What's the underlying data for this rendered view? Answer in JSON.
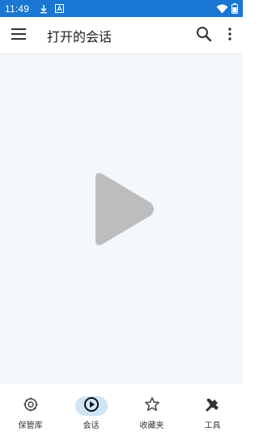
{
  "status_bar": {
    "time": "11:49",
    "icons": [
      "download-icon",
      "app-a-icon",
      "wifi-icon",
      "battery-icon"
    ],
    "background": "#1976d2"
  },
  "app_bar": {
    "title": "打开的会话",
    "icons": [
      "menu-icon",
      "search-icon",
      "more-vert-icon"
    ]
  },
  "content": {
    "icon": "play-icon",
    "background": "#f3f8fd",
    "icon_color": "#bdbdbd"
  },
  "bottom_nav": {
    "items": [
      {
        "label": "保管库",
        "icon": "vault-icon",
        "active": false
      },
      {
        "label": "会话",
        "icon": "play-circle-icon",
        "active": true
      },
      {
        "label": "收藏夹",
        "icon": "star-icon",
        "active": false
      },
      {
        "label": "工具",
        "icon": "tools-icon",
        "active": false
      }
    ],
    "active_color": "#cfe4f7"
  }
}
